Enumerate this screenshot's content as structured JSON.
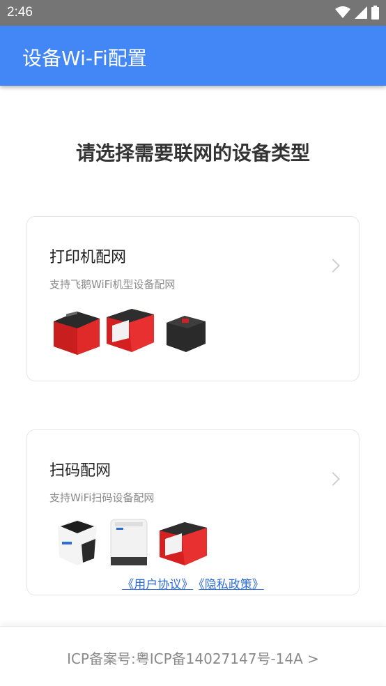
{
  "status_bar": {
    "time": "2:46",
    "icons": [
      "wifi-icon",
      "signal-icon",
      "battery-icon"
    ]
  },
  "app_bar": {
    "title": "设备Wi-Fi配置"
  },
  "heading": "请选择需要联网的设备类型",
  "cards": [
    {
      "title": "打印机配网",
      "subtitle": "支持飞鹅WiFi机型设备配网",
      "devices": [
        "red-printer",
        "red-white-printer",
        "black-label-printer"
      ]
    },
    {
      "title": "扫码配网",
      "subtitle": "支持WiFi扫码设备配网",
      "devices": [
        "black-white-scanner",
        "white-scanner",
        "red-printer"
      ]
    }
  ],
  "links": {
    "user_agreement": "《用户协议》",
    "privacy_policy": "《隐私政策》"
  },
  "footer": {
    "icp": "ICP备案号:粤ICP备14027147号-14A >"
  },
  "colors": {
    "app_bar": "#4287f5",
    "status_bar": "#757575",
    "link": "#2d6bd6",
    "accent_red": "#e02020"
  }
}
